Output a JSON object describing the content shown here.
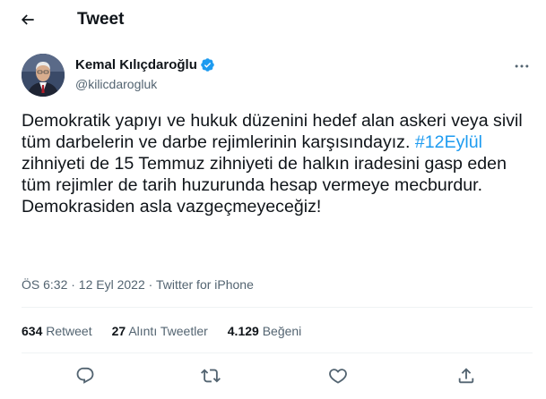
{
  "topbar": {
    "title": "Tweet"
  },
  "author": {
    "name": "Kemal Kılıçdaroğlu",
    "handle": "@kilicdarogluk"
  },
  "tweet": {
    "text_part1": "Demokratik yapıyı ve hukuk düzenini hedef alan askeri veya sivil tüm darbelerin ve darbe rejimlerinin karşısındayız. ",
    "hashtag": "#12Eylül",
    "text_part2": " zihniyeti de 15 Temmuz zihniyeti de halkın iradesini gasp eden tüm rejimler de tarih huzurunda hesap vermeye mecburdur. Demokrasiden asla vazgeçmeyeceğiz!"
  },
  "meta": {
    "text": "ÖS 6:32 · 12 Eyl 2022 · Twitter for iPhone"
  },
  "stats": {
    "retweets": {
      "count": "634",
      "label": "Retweet"
    },
    "quotes": {
      "count": "27",
      "label": "Alıntı Tweetler"
    },
    "likes": {
      "count": "4.129",
      "label": "Beğeni"
    }
  },
  "icons": {
    "back": "arrow-left-icon",
    "verified": "verified-badge-icon",
    "more": "more-horizontal-icon",
    "reply": "reply-icon",
    "retweet": "retweet-icon",
    "like": "heart-icon",
    "share": "share-icon"
  },
  "colors": {
    "accent": "#1d9bf0",
    "text": "#0f1419",
    "muted": "#536471",
    "border": "#eff3f4"
  }
}
